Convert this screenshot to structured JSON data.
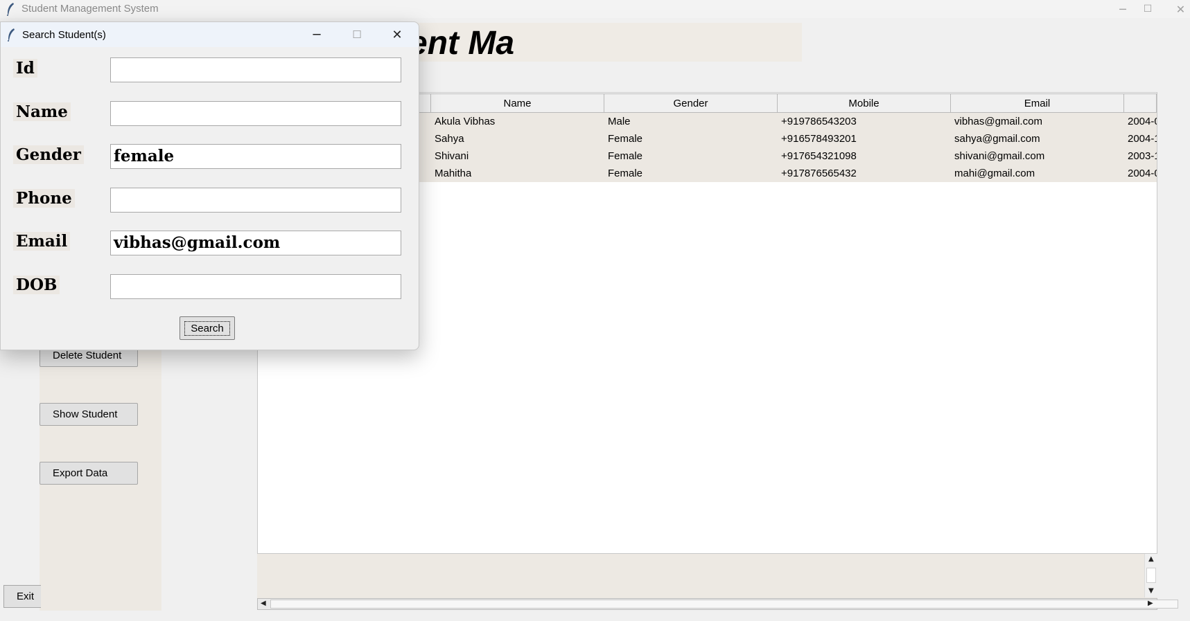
{
  "main_window": {
    "title": "Student Management System",
    "minimize_glyph": "─",
    "maximize_glyph": "☐",
    "close_glyph": "✕"
  },
  "heading": {
    "text": "ent Ma"
  },
  "sidebar": {
    "delete_label": "Delete Student",
    "show_label": "Show Student",
    "export_label": "Export Data",
    "exit_label": "Exit"
  },
  "table": {
    "columns": [
      "Name",
      "Gender",
      "Mobile",
      "Email"
    ],
    "rows": [
      {
        "name": "Akula Vibhas",
        "gender": "Male",
        "mobile": "+919786543203",
        "email": "vibhas@gmail.com",
        "dob": "2004-0"
      },
      {
        "name": "Sahya",
        "gender": "Female",
        "mobile": "+916578493201",
        "email": "sahya@gmail.com",
        "dob": "2004-1"
      },
      {
        "name": "Shivani",
        "gender": "Female",
        "mobile": "+917654321098",
        "email": "shivani@gmail.com",
        "dob": "2003-1"
      },
      {
        "name": "Mahitha",
        "gender": "Female",
        "mobile": "+917876565432",
        "email": "mahi@gmail.com",
        "dob": "2004-0"
      }
    ]
  },
  "dialog": {
    "title": "Search Student(s)",
    "minimize_glyph": "─",
    "maximize_glyph": "☐",
    "close_glyph": "✕",
    "fields": {
      "id": {
        "label": "Id",
        "value": ""
      },
      "name": {
        "label": "Name",
        "value": ""
      },
      "gender": {
        "label": "Gender",
        "value": "female"
      },
      "phone": {
        "label": "Phone",
        "value": ""
      },
      "email": {
        "label": "Email",
        "value": "vibhas@gmail.com"
      },
      "dob": {
        "label": "DOB",
        "value": ""
      }
    },
    "search_label": "Search"
  },
  "colors": {
    "panel_bg": "#ede9e3",
    "dialog_title_bg": "#eef3fa"
  },
  "icons": [
    "feather-icon",
    "minimize-icon",
    "maximize-icon",
    "close-icon",
    "scroll-up-icon",
    "scroll-down-icon",
    "scroll-left-icon",
    "scroll-right-icon"
  ]
}
